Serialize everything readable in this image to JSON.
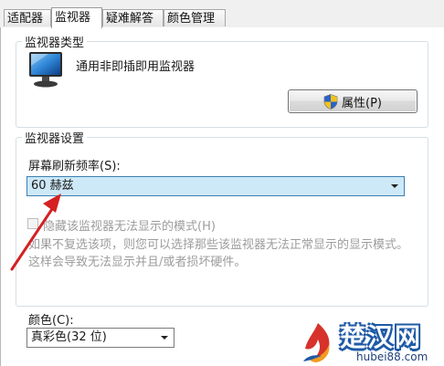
{
  "tabs": [
    {
      "label": "适配器",
      "active": false
    },
    {
      "label": "监视器",
      "active": true
    },
    {
      "label": "疑难解答",
      "active": false
    },
    {
      "label": "颜色管理",
      "active": false
    }
  ],
  "monitor_type": {
    "title": "监视器类型",
    "monitor_name": "通用非即插即用监视器",
    "properties_button": "属性(P)"
  },
  "monitor_settings": {
    "title": "监视器设置",
    "refresh_label": "屏幕刷新频率(S):",
    "refresh_value": "60 赫兹",
    "hide_modes_label": "隐藏该监视器无法显示的模式(H)",
    "hide_modes_checked": false,
    "hide_modes_description": "如果不复选该项，则您可以选择那些该监视器无法正常显示的显示模式。这样会导致无法显示并且/或者损坏硬件。",
    "color_label": "颜色(C):",
    "color_value": "真彩色(32 位)"
  },
  "watermark": {
    "brand": "楚汉网",
    "url": "hubei88.com"
  },
  "colors": {
    "focus_select_bg": "#cde8f7",
    "annotation_arrow": "#d42020",
    "watermark_blue": "#1f5aa6"
  },
  "icons": [
    "monitor-icon",
    "uac-shield-icon",
    "dropdown-arrow-icon",
    "annotation-arrow"
  ]
}
